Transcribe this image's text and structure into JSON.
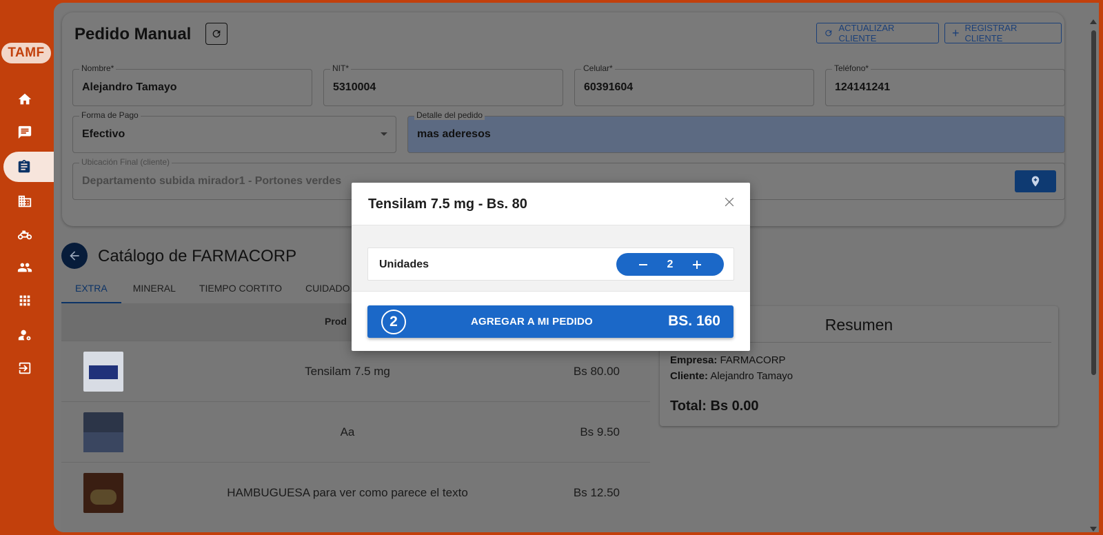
{
  "sidebar": {
    "logo": "TAMF",
    "items": [
      {
        "icon": "home-icon"
      },
      {
        "icon": "chat-icon"
      },
      {
        "icon": "clipboard-icon",
        "active": true
      },
      {
        "icon": "building-icon"
      },
      {
        "icon": "motorcycle-icon"
      },
      {
        "icon": "users-icon"
      },
      {
        "icon": "apps-grid-icon"
      },
      {
        "icon": "user-settings-icon"
      },
      {
        "icon": "logout-icon"
      }
    ]
  },
  "header": {
    "title": "Pedido Manual",
    "update_client_label": "ACTUALIZAR CLIENTE",
    "register_client_label": "REGISTRAR CLIENTE"
  },
  "form": {
    "nombre": {
      "label": "Nombre*",
      "value": "Alejandro Tamayo"
    },
    "nit": {
      "label": "NIT*",
      "value": "5310004"
    },
    "celular": {
      "label": "Celular*",
      "value": "60391604"
    },
    "telefono": {
      "label": "Teléfono*",
      "value": "124141241"
    },
    "forma_pago": {
      "label": "Forma de Pago",
      "value": "Efectivo"
    },
    "detalle": {
      "label": "Detalle del pedido",
      "value": "mas aderesos"
    },
    "ubicacion": {
      "label": "Ubicación Final (cliente)",
      "value": "Departamento subida mirador1 - Portones verdes"
    }
  },
  "catalog": {
    "title": "Catálogo de FARMACORP",
    "tabs": [
      "EXTRA",
      "MINERAL",
      "TIEMPO CORTITO",
      "CUIDADO"
    ],
    "active_tab": "EXTRA",
    "column_header": "Prod",
    "rows": [
      {
        "name": "Tensilam 7.5 mg",
        "price": "Bs 80.00"
      },
      {
        "name": "Aa",
        "price": "Bs 9.50"
      },
      {
        "name": "HAMBUGUESA para ver como parece el texto",
        "price": "Bs 12.50"
      }
    ]
  },
  "summary": {
    "title": "Resumen",
    "empresa_label": "Empresa:",
    "empresa_value": "FARMACORP",
    "cliente_label": "Cliente:",
    "cliente_value": "Alejandro Tamayo",
    "total": "Total: Bs 0.00"
  },
  "modal": {
    "title": "Tensilam 7.5 mg - Bs. 80",
    "units_label": "Unidades",
    "quantity": "2",
    "add_count": "2",
    "add_label": "AGREGAR A MI PEDIDO",
    "add_total": "BS. 160"
  },
  "colors": {
    "brand": "#c2400c",
    "primary": "#1b68c8"
  }
}
